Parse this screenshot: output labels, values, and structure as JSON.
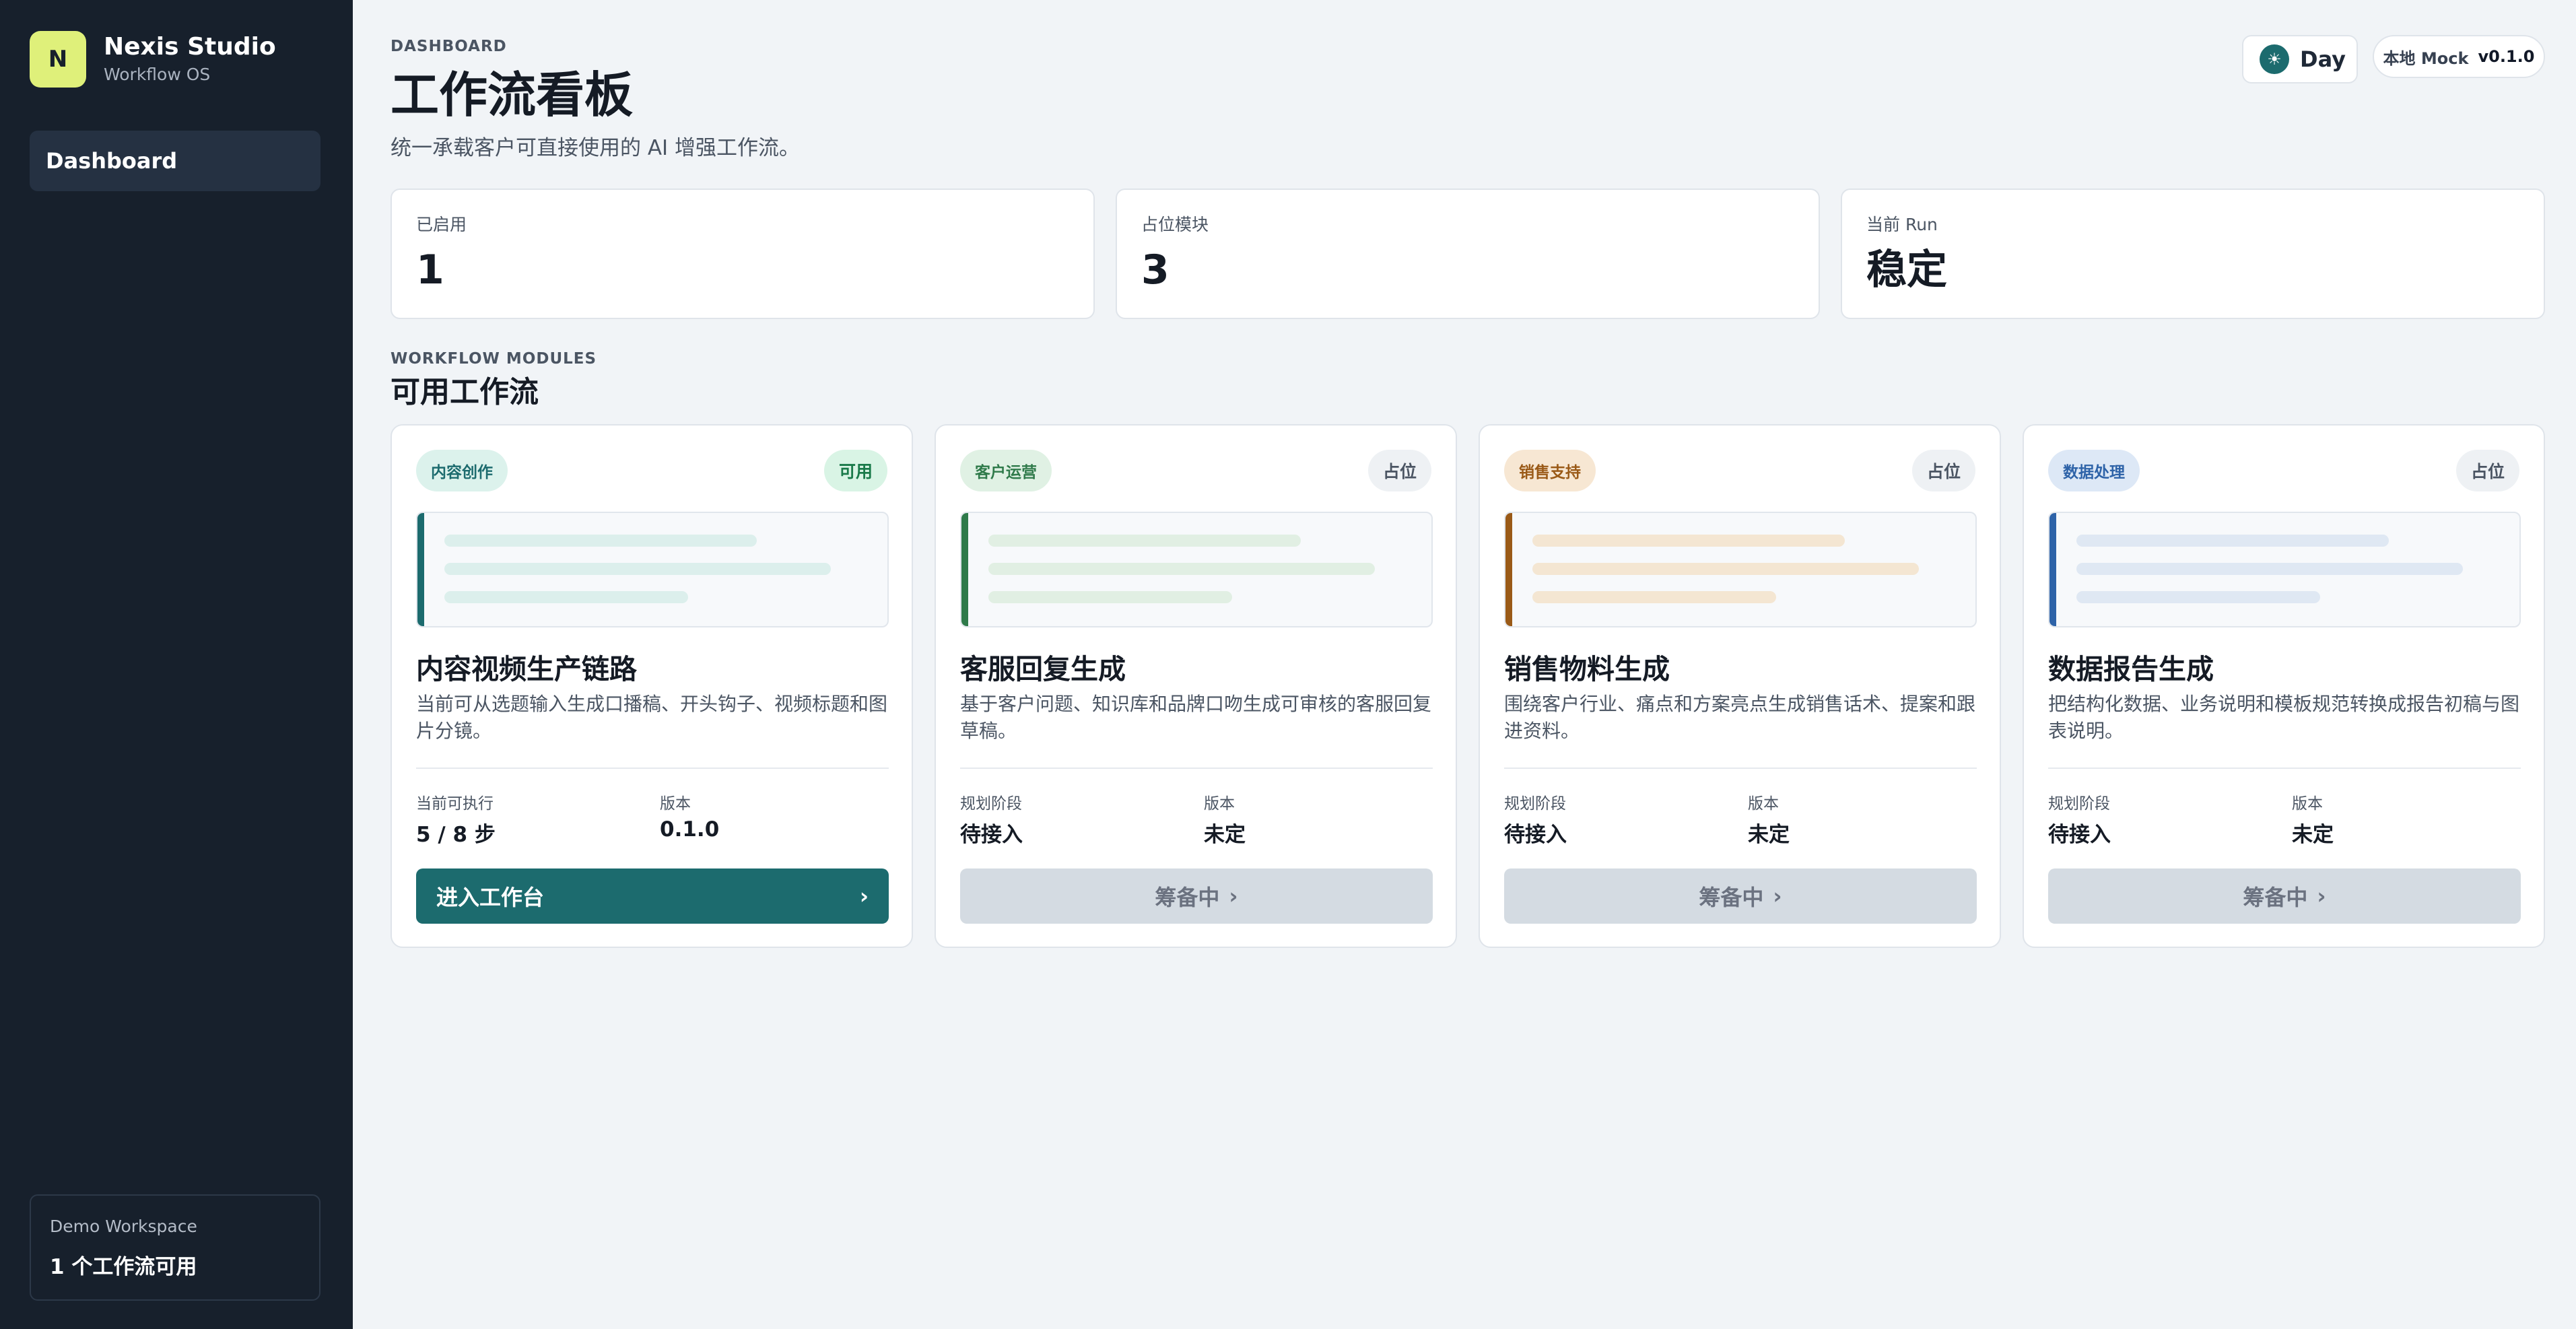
{
  "sidebar": {
    "brand_initial": "N",
    "brand_name": "Nexis Studio",
    "brand_sub": "Workflow OS",
    "nav": [
      {
        "label": "Dashboard",
        "active": true
      }
    ],
    "workspace": {
      "label": "Demo Workspace",
      "value": "1 个工作流可用"
    }
  },
  "header": {
    "eyebrow": "DASHBOARD",
    "title": "工作流看板",
    "subtitle": "统一承载客户可直接使用的 AI 增强工作流。",
    "theme_label": "Day",
    "theme_icon": "sun-icon",
    "env_label": "本地 Mock",
    "env_version": "v0.1.0"
  },
  "stats": [
    {
      "label": "已启用",
      "value": "1"
    },
    {
      "label": "占位模块",
      "value": "3"
    },
    {
      "label": "当前 Run",
      "value": "稳定"
    }
  ],
  "modules_section": {
    "eyebrow": "WORKFLOW MODULES",
    "title": "可用工作流"
  },
  "cards": [
    {
      "tag": "内容创作",
      "status": "可用",
      "title": "内容视频生产链路",
      "desc": "当前可从选题输入生成口播稿、开头钩子、视频标题和图片分镜。",
      "meta1_label": "当前可执行",
      "meta1_value": "5 / 8 步",
      "meta2_label": "版本",
      "meta2_value": "0.1.0",
      "button": "进入工作台",
      "enabled": true,
      "accent": "#1c6b6e"
    },
    {
      "tag": "客户运营",
      "status": "占位",
      "title": "客服回复生成",
      "desc": "基于客户问题、知识库和品牌口吻生成可审核的客服回复草稿。",
      "meta1_label": "规划阶段",
      "meta1_value": "待接入",
      "meta2_label": "版本",
      "meta2_value": "未定",
      "button": "筹备中",
      "enabled": false,
      "accent": "#2f7a4a"
    },
    {
      "tag": "销售支持",
      "status": "占位",
      "title": "销售物料生成",
      "desc": "围绕客户行业、痛点和方案亮点生成销售话术、提案和跟进资料。",
      "meta1_label": "规划阶段",
      "meta1_value": "待接入",
      "meta2_label": "版本",
      "meta2_value": "未定",
      "button": "筹备中",
      "enabled": false,
      "accent": "#9a5a17"
    },
    {
      "tag": "数据处理",
      "status": "占位",
      "title": "数据报告生成",
      "desc": "把结构化数据、业务说明和模板规范转换成报告初稿与图表说明。",
      "meta1_label": "规划阶段",
      "meta1_value": "待接入",
      "meta2_label": "版本",
      "meta2_value": "未定",
      "button": "筹备中",
      "enabled": false,
      "accent": "#2e63a8"
    }
  ]
}
